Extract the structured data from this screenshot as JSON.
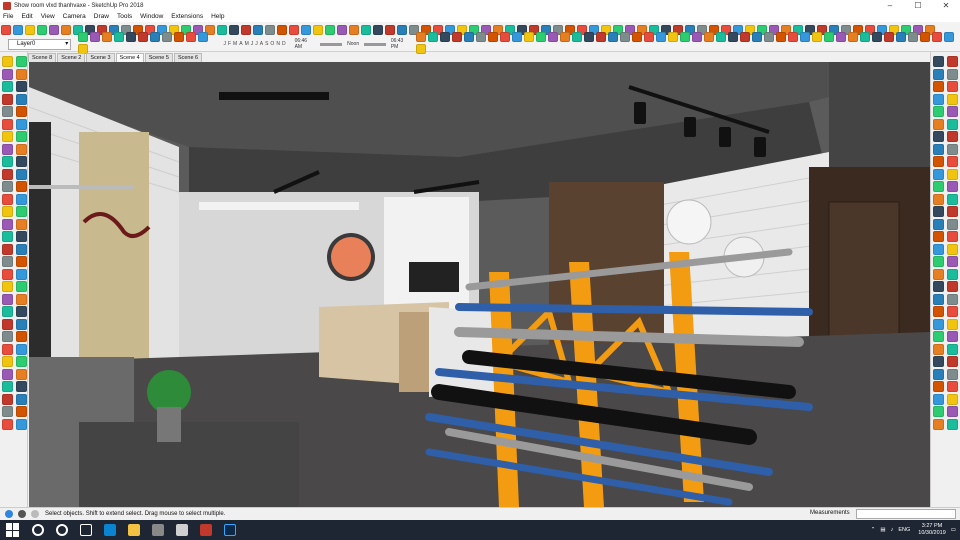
{
  "window": {
    "title": "Show room vlxd thanhvaxe - SketchUp Pro 2018",
    "controls": {
      "minimize": "–",
      "maximize": "☐",
      "close": "✕"
    }
  },
  "menu": [
    "File",
    "Edit",
    "View",
    "Camera",
    "Draw",
    "Tools",
    "Window",
    "Extensions",
    "Help"
  ],
  "toolbar": {
    "layer": "Layer0",
    "months": [
      "J",
      "F",
      "M",
      "A",
      "M",
      "J",
      "J",
      "A",
      "S",
      "O",
      "N",
      "D"
    ],
    "time_start": "06:46 AM",
    "time_label": "Noon",
    "time_end": "06:43 PM"
  },
  "scenes": [
    "Scene 8",
    "Scene 2",
    "Scene 3",
    "Scene 4",
    "Scene 5",
    "Scene 6"
  ],
  "active_scene": "Scene 4",
  "status": {
    "hint": "Select objects. Shift to extend select. Drag mouse to select multiple.",
    "measurements_label": "Measurements"
  },
  "taskbar": {
    "language": "ENG",
    "time": "3:27 PM",
    "date": "10/30/2019"
  },
  "colors": {
    "accent": "#0078d7",
    "taskbar": "#1f2633",
    "rack_orange": "#f39c12",
    "rack_blue": "#2e5fa8"
  }
}
